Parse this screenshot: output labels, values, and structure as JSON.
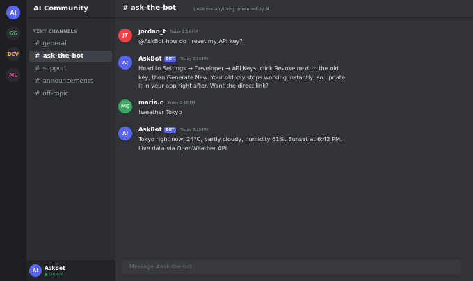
{
  "servers": [
    {
      "initials": "AI",
      "color": "#5865f2"
    },
    {
      "initials": "GG",
      "color": "#3ba55d"
    },
    {
      "initials": "DEV",
      "color": "#faa61a"
    },
    {
      "initials": "ML",
      "color": "#eb459e"
    }
  ],
  "sidebar": {
    "server_name": "AI Community",
    "category": "TEXT CHANNELS",
    "channels": [
      {
        "label": "general"
      },
      {
        "label": "ask-the-bot"
      },
      {
        "label": "support"
      },
      {
        "label": "announcements"
      },
      {
        "label": "off-topic"
      }
    ]
  },
  "user": {
    "initials": "AI",
    "name": "AskBot",
    "status": "Online"
  },
  "header": {
    "title": "# ask-the-bot",
    "topic": "| Ask me anything, powered by AI"
  },
  "messages": [
    {
      "initials": "JT",
      "author": "jordan_t",
      "time": "Today 2:14 PM",
      "text": "@AskBot how do I reset my API key?",
      "avatar_color": "#ed4245"
    },
    {
      "initials": "AI",
      "author": "AskBot",
      "badge": "BOT",
      "time": "Today 2:14 PM",
      "text": "Head to Settings → Developer → API Keys, click Revoke next to the old key, then Generate New. Your old key stops working instantly, so update it in your app right after. Want the direct link?",
      "avatar_color": "#5865f2"
    },
    {
      "initials": "MC",
      "author": "maria.c",
      "time": "Today 2:16 PM",
      "text": "!weather Tokyo",
      "avatar_color": "#3ba55d"
    },
    {
      "initials": "AI",
      "author": "AskBot",
      "badge": "BOT",
      "time": "Today 2:16 PM",
      "text": "Tokyo right now: 24°C, partly cloudy, humidity 61%. Sunset at 6:42 PM.\nLive data via OpenWeather API.",
      "avatar_color": "#5865f2"
    }
  ],
  "composer": {
    "placeholder": "Message #ask-the-bot"
  }
}
